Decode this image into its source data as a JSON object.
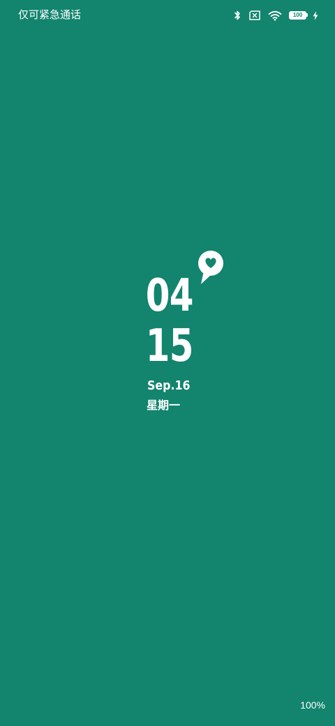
{
  "status_bar": {
    "carrier_text": "仅可紧急通话",
    "icons": [
      "bluetooth-icon",
      "no-sim-icon",
      "wifi-icon",
      "battery-icon",
      "charging-bolt-icon"
    ],
    "battery_level": "100",
    "is_charging": true
  },
  "clock": {
    "hour": "04",
    "minute": "15",
    "date": "Sep.16",
    "weekday": "星期一"
  },
  "widget": {
    "icon": "heart-speech-bubble-icon"
  },
  "footer": {
    "zoom_level": "100%"
  },
  "colors": {
    "background": "#13846E",
    "foreground": "#FFFFFF"
  }
}
